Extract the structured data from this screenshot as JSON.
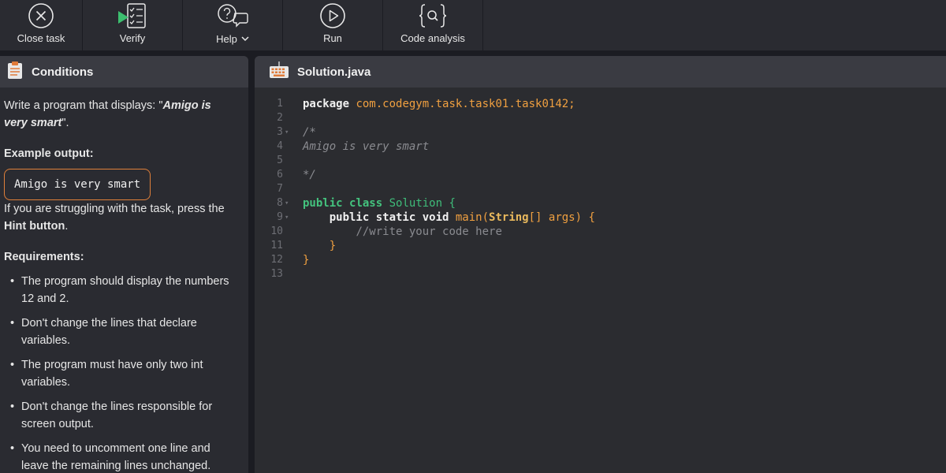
{
  "toolbar": {
    "close_label": "Close task",
    "verify_label": "Verify",
    "help_label": "Help",
    "run_label": "Run",
    "analysis_label": "Code analysis",
    "accent": "#3cbf6f"
  },
  "conditions": {
    "title": "Conditions",
    "intro_prefix": "Write a program that displays: \"",
    "intro_quote": "Amigo is very smart",
    "intro_suffix": "\".",
    "example_heading": "Example output:",
    "example_output": "Amigo is very smart",
    "struggle_prefix": "If you are struggling with the task, press the ",
    "struggle_bold": "Hint button",
    "struggle_suffix": ".",
    "requirements_heading": "Requirements:",
    "requirements": [
      "The program should display the numbers 12 and 2.",
      "Don't change the lines that declare variables.",
      "The program must have only two int variables.",
      "Don't change the lines responsible for screen output.",
      "You need to uncomment one line and leave the remaining lines unchanged."
    ]
  },
  "editor": {
    "filename": "Solution.java",
    "line_numbers": [
      "1",
      "2",
      "3",
      "4",
      "5",
      "6",
      "7",
      "8",
      "9",
      "10",
      "11",
      "12",
      "13"
    ],
    "code": {
      "package_kw": "package",
      "package_name": "com.codegym.task.task01.task0142;",
      "comment_open": "/*",
      "comment_text": "Amigo is very smart",
      "comment_close": "*/",
      "public_kw": "public",
      "class_kw": "class",
      "class_name": "Solution {",
      "main_mods": "public static void",
      "main_name": "main(",
      "string_type": "String",
      "main_args": "[] args) {",
      "todo_comment": "//write your code here",
      "close_inner": "}",
      "close_outer": "}"
    }
  }
}
